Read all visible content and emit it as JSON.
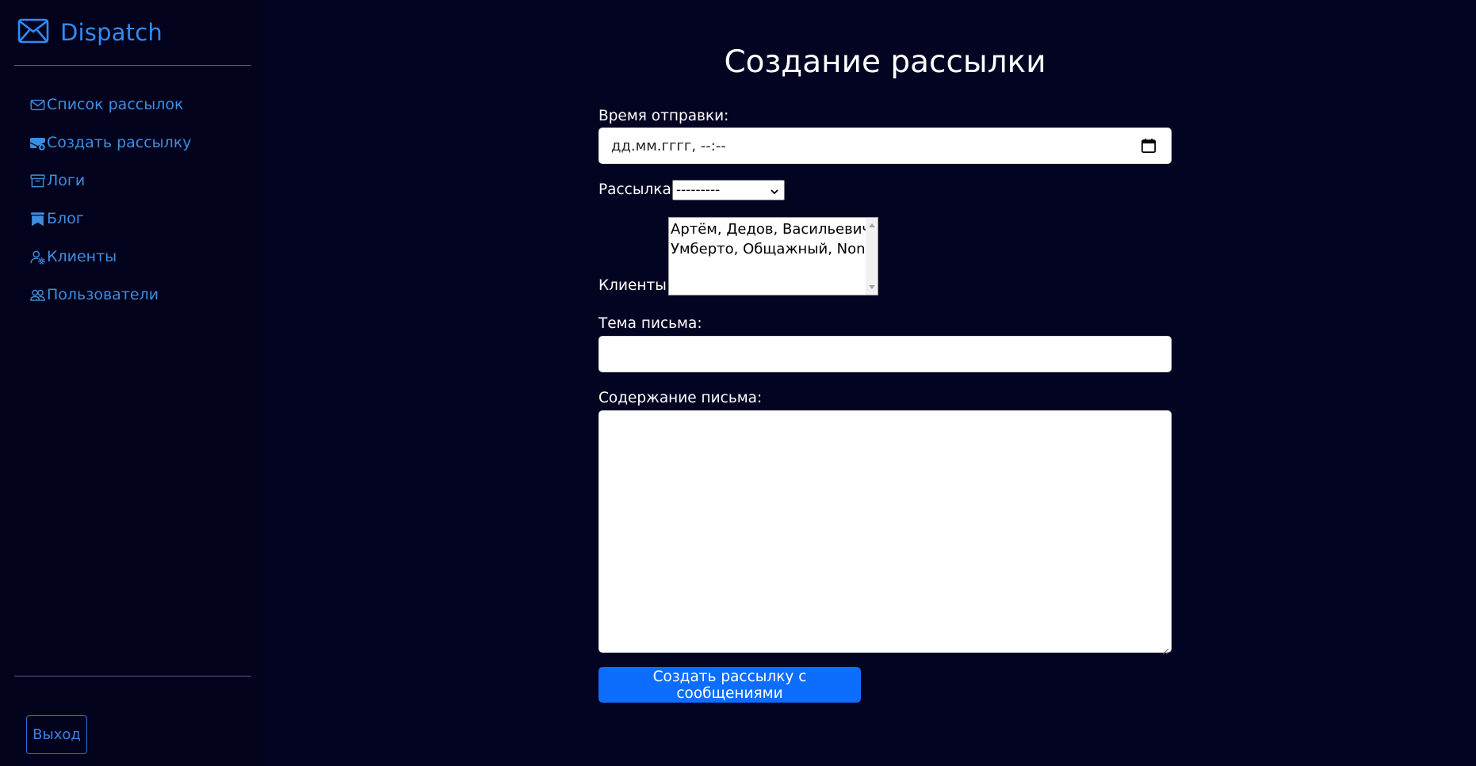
{
  "app": {
    "brand": "Dispatch",
    "accent": "#2f8cf4"
  },
  "sidebar": {
    "items": [
      {
        "label": "Список рассылок",
        "icon": "envelope-icon"
      },
      {
        "label": "Создать рассылку",
        "icon": "envelope-plus-icon"
      },
      {
        "label": "Логи",
        "icon": "archive-icon"
      },
      {
        "label": "Блог",
        "icon": "bookmarks-icon"
      },
      {
        "label": "Клиенты",
        "icon": "person-gear-icon"
      },
      {
        "label": "Пользователи",
        "icon": "people-icon"
      }
    ],
    "logout_label": "Выход"
  },
  "form": {
    "title": "Создание рассылки",
    "send_time_label": "Время отправки:",
    "send_time_value": "дд.мм.гггг, --:--",
    "mailing_label": "Рассылка:",
    "mailing_selected": "---------",
    "clients_label": "Клиенты:",
    "clients_options": [
      "Артём, Дедов, Васильевич",
      "Умберто, Общажный, None"
    ],
    "subject_label": "Тема письма:",
    "subject_value": "",
    "body_label": "Содержание письма:",
    "body_value": "",
    "submit_label": "Создать рассылку с сообщениями",
    "submit_color": "#0d6efd"
  }
}
